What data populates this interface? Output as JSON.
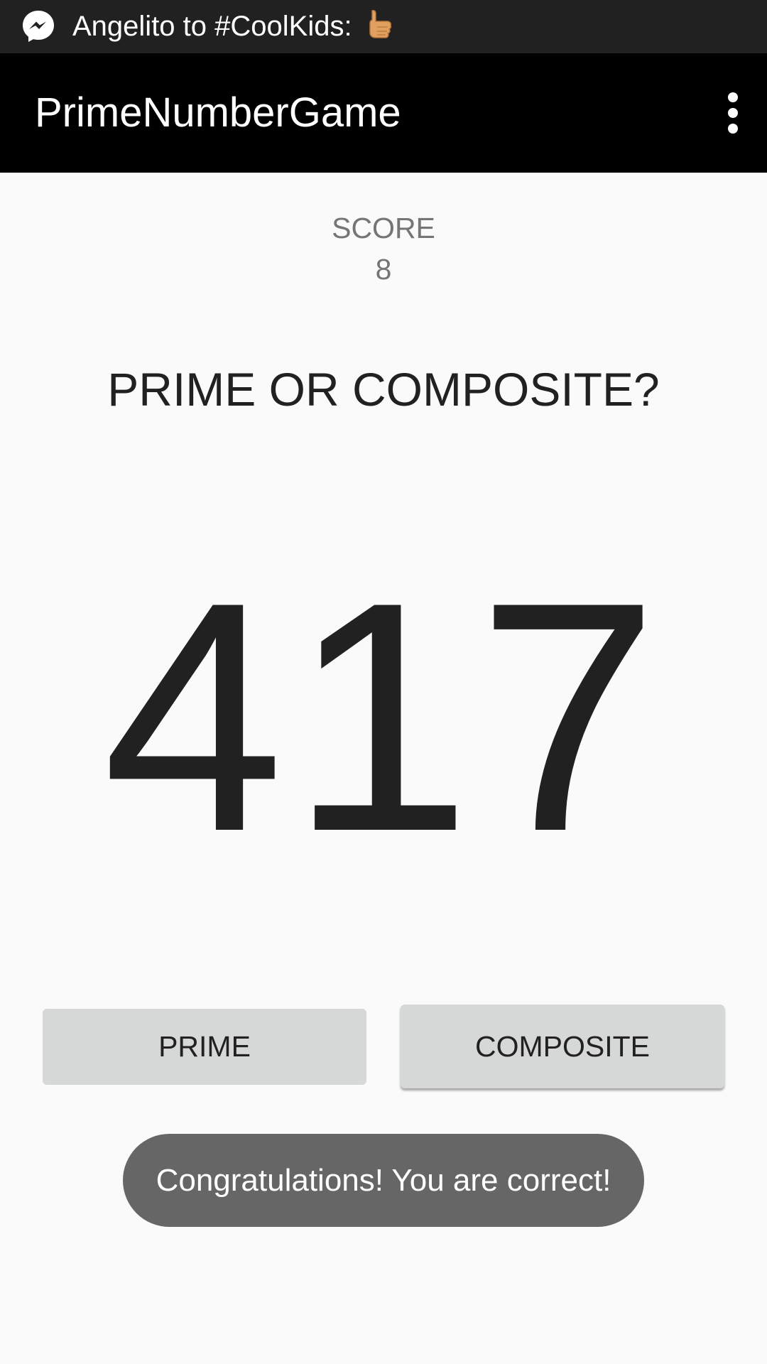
{
  "status_bar": {
    "notification_text": "Angelito to #CoolKids:",
    "app_icon": "messenger-icon",
    "emoji_icon": "thumbs-up-icon"
  },
  "app_bar": {
    "title": "PrimeNumberGame",
    "menu_icon": "overflow-menu-icon"
  },
  "score": {
    "label": "SCORE",
    "value": "8"
  },
  "question": "PRIME OR COMPOSITE?",
  "number": "417",
  "buttons": {
    "prime_label": "PRIME",
    "composite_label": "COMPOSITE"
  },
  "toast": "Congratulations! You are correct!",
  "colors": {
    "status_bar": "#212121",
    "app_bar": "#000000",
    "background": "#fafafa",
    "button": "#d6d7d7",
    "toast": "#666666"
  }
}
